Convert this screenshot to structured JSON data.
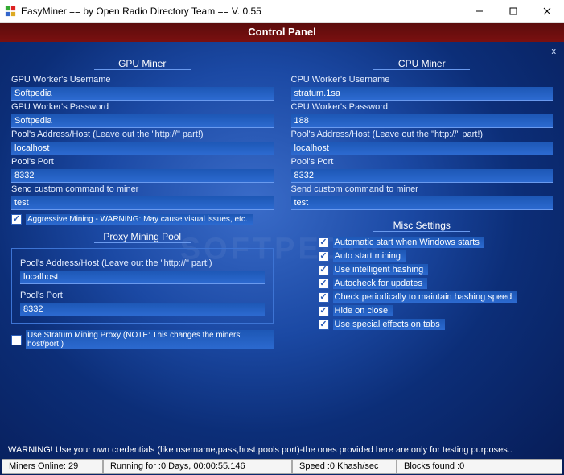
{
  "window": {
    "title": "EasyMiner == by Open Radio Directory Team == V. 0.55"
  },
  "panel": {
    "title": "Control Panel",
    "close": "x",
    "watermark": "SOFTPEDIA"
  },
  "gpu": {
    "header": "GPU Miner",
    "userLabel": "GPU Worker's Username",
    "user": "Softpedia",
    "passLabel": "GPU Worker's Password",
    "pass": "Softpedia",
    "hostLabel": "Pool's Address/Host (Leave out the \"http://\" part!)",
    "host": "localhost",
    "portLabel": "Pool's Port",
    "port": "8332",
    "cmdLabel": "Send custom command to miner",
    "cmd": "test",
    "aggressive": "Aggressive Mining - WARNING: May cause visual issues, etc."
  },
  "cpu": {
    "header": "CPU Miner",
    "userLabel": "CPU Worker's Username",
    "user": "stratum.1sa",
    "passLabel": "CPU Worker's Password",
    "pass": "188",
    "hostLabel": "Pool's Address/Host (Leave out the \"http://\" part!)",
    "host": "localhost",
    "portLabel": "Pool's Port",
    "port": "8332",
    "cmdLabel": "Send custom command to miner",
    "cmd": "test"
  },
  "proxy": {
    "header": "Proxy Mining Pool",
    "hostLabel": "Pool's Address/Host (Leave out the \"http://\" part!)",
    "host": "localhost",
    "portLabel": "Pool's Port",
    "port": "8332",
    "useStratum": "Use Stratum Mining Proxy (NOTE: This changes the miners' host/port )"
  },
  "misc": {
    "header": "Misc Settings",
    "m1": "Automatic start when Windows starts",
    "m2": "Auto start mining",
    "m3": "Use intelligent hashing",
    "m4": "Autocheck for updates",
    "m5": "Check periodically to maintain hashing speed",
    "m6": "Hide on close",
    "m7": "Use special effects on tabs"
  },
  "warning": "WARNING! Use your own credentials (like username,pass,host,pools port)-the ones provided here are only for testing purposes..",
  "status": {
    "online": "Miners Online: 29",
    "running": "Running for :0 Days, 00:00:55.146",
    "speed": "Speed :0 Khash/sec",
    "blocks": "Blocks found :0"
  }
}
